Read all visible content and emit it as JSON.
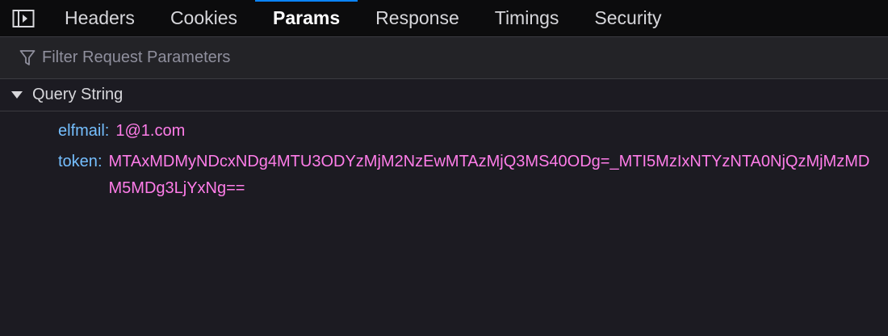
{
  "tabs": [
    {
      "label": "Headers",
      "active": false
    },
    {
      "label": "Cookies",
      "active": false
    },
    {
      "label": "Params",
      "active": true
    },
    {
      "label": "Response",
      "active": false
    },
    {
      "label": "Timings",
      "active": false
    },
    {
      "label": "Security",
      "active": false
    }
  ],
  "filter": {
    "placeholder": "Filter Request Parameters",
    "value": ""
  },
  "section": {
    "title": "Query String",
    "expanded": true
  },
  "params": [
    {
      "key": "elfmail",
      "value": "1@1.com"
    },
    {
      "key": "token",
      "value": "MTAxMDMyNDcxNDg4MTU3ODYzMjM2NzEwMTAzMjQ3MS40ODg=_MTI5MzIxNTYzNTA0NjQzMjMzMDM5MDg3LjYxNg=="
    }
  ],
  "colors": {
    "accent": "#0a84ff",
    "key": "#75bfff",
    "value": "#ff7de9",
    "background": "#1c1b22"
  },
  "icons": {
    "panel_toggle": "sidebar-toggle-icon",
    "filter": "filter-funnel-icon",
    "section": "triangle-down-icon"
  }
}
